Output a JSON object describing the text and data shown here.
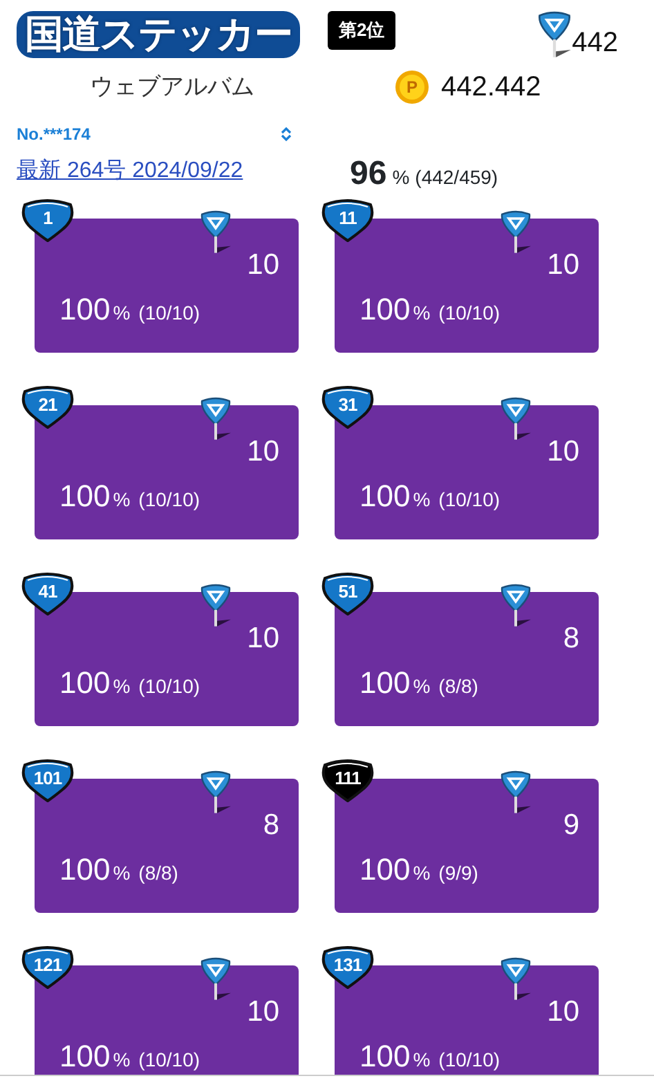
{
  "header": {
    "logo": "国道ステッカー",
    "subtitle": "ウェブアルバム",
    "rank": "第2位",
    "sticker_total": "442",
    "points": "442.442",
    "coin_label": "P",
    "member_select": {
      "value": "No.***174"
    },
    "latest_link": "最新 264号 2024/09/22",
    "progress": {
      "percent": "96",
      "unit": "%",
      "ratio": "(442/459)"
    }
  },
  "groups": [
    {
      "number": "1",
      "color": "#1577c8",
      "count": "10",
      "percent": "100",
      "unit": "%",
      "ratio": "(10/10)"
    },
    {
      "number": "11",
      "color": "#1577c8",
      "count": "10",
      "percent": "100",
      "unit": "%",
      "ratio": "(10/10)"
    },
    {
      "number": "21",
      "color": "#1577c8",
      "count": "10",
      "percent": "100",
      "unit": "%",
      "ratio": "(10/10)"
    },
    {
      "number": "31",
      "color": "#1577c8",
      "count": "10",
      "percent": "100",
      "unit": "%",
      "ratio": "(10/10)"
    },
    {
      "number": "41",
      "color": "#1577c8",
      "count": "10",
      "percent": "100",
      "unit": "%",
      "ratio": "(10/10)"
    },
    {
      "number": "51",
      "color": "#1577c8",
      "count": "8",
      "percent": "100",
      "unit": "%",
      "ratio": "(8/8)"
    },
    {
      "number": "101",
      "color": "#1577c8",
      "count": "8",
      "percent": "100",
      "unit": "%",
      "ratio": "(8/8)"
    },
    {
      "number": "111",
      "color": "#000000",
      "count": "9",
      "percent": "100",
      "unit": "%",
      "ratio": "(9/9)"
    },
    {
      "number": "121",
      "color": "#1577c8",
      "count": "10",
      "percent": "100",
      "unit": "%",
      "ratio": "(10/10)"
    },
    {
      "number": "131",
      "color": "#1577c8",
      "count": "10",
      "percent": "100",
      "unit": "%",
      "ratio": "(10/10)"
    }
  ]
}
